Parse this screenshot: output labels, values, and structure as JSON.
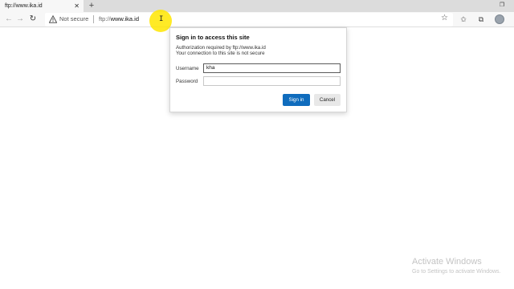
{
  "tab": {
    "title": "ftp://www.ika.id",
    "close_glyph": "✕"
  },
  "new_tab_glyph": "+",
  "window_controls": {
    "minimize": "—",
    "restore": "❐",
    "close": "✕"
  },
  "nav": {
    "back_glyph": "←",
    "forward_glyph": "→",
    "reload_glyph": "↻"
  },
  "address": {
    "security_text": "Not secure",
    "url_scheme": "ftp://",
    "url_host": "www.ika.id"
  },
  "toolbar_icons": {
    "star": "☆",
    "favorites": "✩",
    "collections": "⧉"
  },
  "dialog": {
    "title": "Sign in to access this site",
    "auth_line": "Authorization required by ftp://www.ika.id",
    "warning_line": "Your connection to this site is not secure",
    "username_label": "Username",
    "username_value": "kha",
    "password_label": "Password",
    "password_value": "",
    "sign_in_label": "Sign in",
    "cancel_label": "Cancel"
  },
  "watermark": {
    "title": "Activate Windows",
    "subtitle": "Go to Settings to activate Windows."
  },
  "colors": {
    "accent": "#0f6cbd",
    "cursor_highlight": "#ffe600"
  }
}
